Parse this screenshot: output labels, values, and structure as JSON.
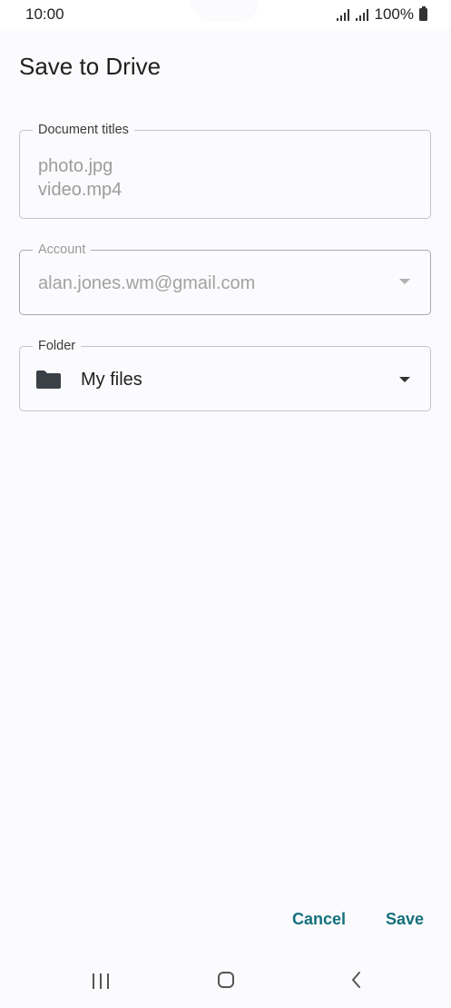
{
  "status_bar": {
    "time": "10:00",
    "battery": "100%"
  },
  "page": {
    "title": "Save to Drive"
  },
  "document_titles": {
    "label": "Document titles",
    "values": [
      "photo.jpg",
      "video.mp4"
    ]
  },
  "account": {
    "label": "Account",
    "value": "alan.jones.wm@gmail.com"
  },
  "folder": {
    "label": "Folder",
    "value": "My files",
    "icon": "folder-icon"
  },
  "actions": {
    "cancel_label": "Cancel",
    "save_label": "Save"
  },
  "colors": {
    "accent": "#13707c",
    "background": "#fbfbfe"
  },
  "nav_bar": {
    "icons": [
      "recent-apps-icon",
      "home-icon",
      "back-icon"
    ]
  }
}
